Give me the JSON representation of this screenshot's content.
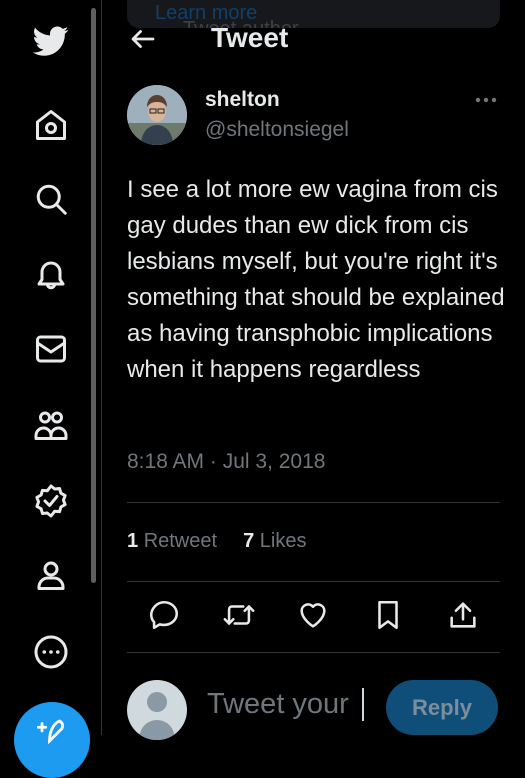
{
  "header": {
    "title": "Tweet"
  },
  "notice": {
    "text": "Tweet author",
    "link": "Learn more"
  },
  "tweet": {
    "author_name": "shelton",
    "author_handle": "@sheltonsiegel",
    "text": "I see a lot more ew vagina from cis gay dudes than ew dick from cis lesbians myself, but you're right it's something that should be explained as having transphobic implications when it happens regardless",
    "time": "8:18 AM · Jul 3, 2018",
    "retweet_count": "1",
    "retweet_label": "Retweet",
    "like_count": "7",
    "like_label": "Likes"
  },
  "reply": {
    "placeholder": "Tweet your",
    "button_label": "Reply"
  },
  "colors": {
    "accent": "#1d9bf0",
    "background": "#000000",
    "muted_text": "#71767b"
  },
  "sidebar_icons": [
    "twitter-logo-icon",
    "home-icon",
    "search-icon",
    "bell-icon",
    "mail-icon",
    "communities-icon",
    "verified-icon",
    "profile-icon",
    "more-icon"
  ]
}
